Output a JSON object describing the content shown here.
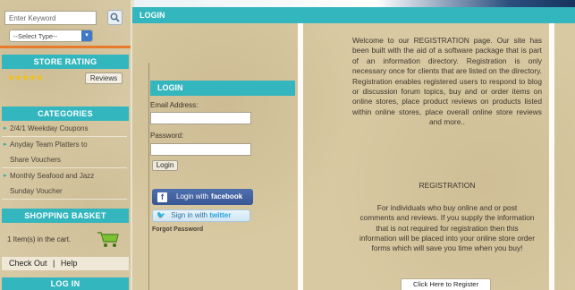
{
  "colors": {
    "accent": "#33b6bd",
    "orange_bar": "#e87a2b",
    "facebook": "#3a5795",
    "twitter": "#2b9ed8"
  },
  "search": {
    "placeholder": "Enter Keyword",
    "icon": "search-icon"
  },
  "type_select": {
    "value": "--Select Type--"
  },
  "sidebar": {
    "store_rating": {
      "title": "STORE RATING",
      "stars": 5,
      "reviews_label": "Reviews"
    },
    "categories": {
      "title": "CATEGORIES",
      "items": [
        {
          "label": "2/4/1 Weekday Coupons"
        },
        {
          "label": "Anyday Team Platters to"
        },
        {
          "label": "Share Vouchers"
        },
        {
          "label": "Monthly Seafood and Jazz"
        },
        {
          "label": "Sunday Voucher"
        }
      ]
    },
    "shopping_basket": {
      "title": "SHOPPING BASKET",
      "cart_text": "1 Item(s) in the cart."
    },
    "account": {
      "checkout_label": "Check Out",
      "separator": "|",
      "help_label": "Help"
    },
    "login_title": "LOG IN"
  },
  "main": {
    "header": "LOGIN",
    "login": {
      "title": "LOGIN",
      "email_label": "Email Address:",
      "password_label": "Password:",
      "login_button": "Login",
      "facebook_label": "Login with",
      "facebook_brand": "facebook",
      "twitter_label": "Sign in with",
      "twitter_brand": "twitter",
      "forgot_label": "Forgot Password"
    },
    "welcome_text": "Welcome to our REGISTRATION page. Our site has been built with the aid of a software package that is part of an information directory. Registration is only necessary once for clients that are listed on the directory. Registration enables registered users to respond to blog or discussion forum topics, buy and or order items on online stores, place product reviews on products listed within online stores, place overall online store reviews and more..",
    "registration_title": "REGISTRATION",
    "registration_text": "For individuals who buy online and or post comments and reviews. If you supply the information that is not required for registration then this information will be placed into your online store order forms which will save you time when you buy!",
    "register_button": "Click Here to Register"
  }
}
